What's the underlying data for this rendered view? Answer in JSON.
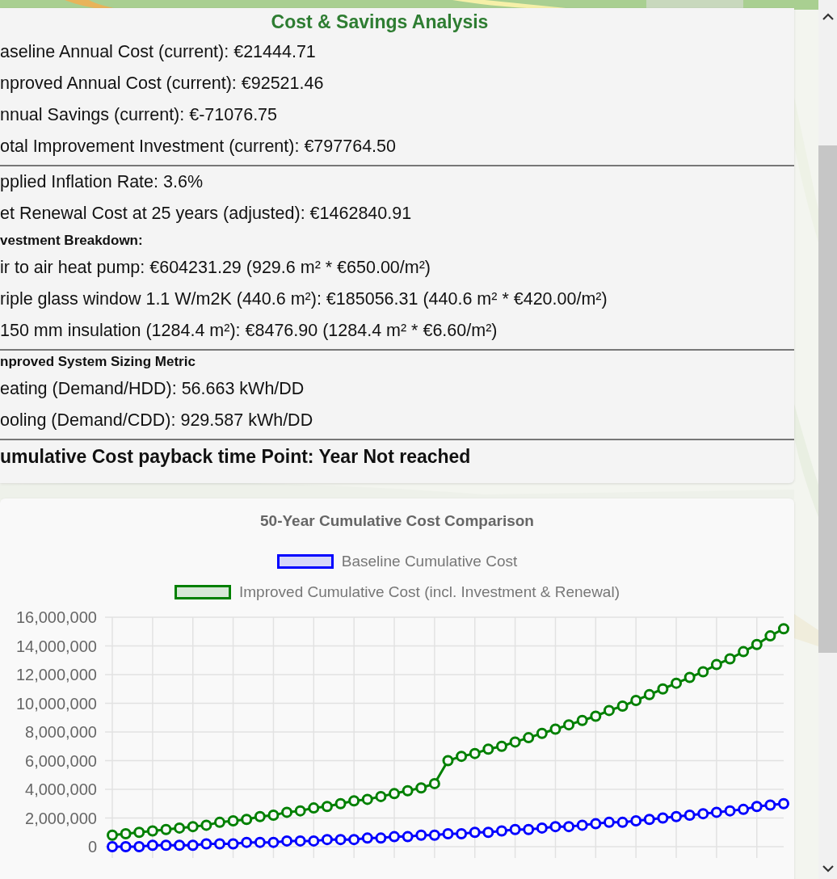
{
  "panel": {
    "title": "Cost & Savings Analysis",
    "groups": [
      {
        "rows": [
          {
            "kind": "line",
            "text": "aseline Annual Cost (current): €21444.71"
          },
          {
            "kind": "line",
            "text": "nproved Annual Cost (current): €92521.46"
          },
          {
            "kind": "line",
            "text": "nnual Savings (current): €-71076.75"
          },
          {
            "kind": "line",
            "text": "otal Improvement Investment (current): €797764.50"
          }
        ]
      },
      {
        "rows": [
          {
            "kind": "line",
            "text": "pplied Inflation Rate: 3.6%"
          },
          {
            "kind": "line",
            "text": "et Renewal Cost at 25 years (adjusted): €1462840.91"
          },
          {
            "kind": "heading",
            "text": "vestment Breakdown:"
          },
          {
            "kind": "line",
            "text": "ir to air heat pump: €604231.29 (929.6 m² * €650.00/m²)"
          },
          {
            "kind": "line",
            "text": "riple glass window 1.1 W/m2K (440.6 m²): €185056.31 (440.6 m² * €420.00/m²)"
          },
          {
            "kind": "line",
            "text": "150 mm insulation (1284.4 m²): €8476.90 (1284.4 m² * €6.60/m²)"
          }
        ]
      },
      {
        "rows": [
          {
            "kind": "heading",
            "text": "nproved System Sizing Metric"
          },
          {
            "kind": "line",
            "text": "eating (Demand/HDD): 56.663 kWh/DD"
          },
          {
            "kind": "line",
            "text": "ooling (Demand/CDD): 929.587 kWh/DD"
          }
        ]
      },
      {
        "rows": [
          {
            "kind": "result",
            "text": "umulative Cost payback time Point: Year Not reached"
          }
        ]
      }
    ]
  },
  "chart": {
    "chart_data": {
      "type": "line",
      "title": "50-Year Cumulative Cost Comparison",
      "grid": true,
      "series": [
        {
          "name": "Baseline Cumulative Cost",
          "color": "#0000ff",
          "marker": "circle",
          "values": [
            0,
            0,
            0,
            100000,
            100000,
            100000,
            100000,
            200000,
            200000,
            200000,
            300000,
            300000,
            300000,
            400000,
            400000,
            400000,
            500000,
            500000,
            500000,
            600000,
            600000,
            700000,
            700000,
            800000,
            800000,
            900000,
            900000,
            1000000,
            1000000,
            1100000,
            1200000,
            1200000,
            1300000,
            1400000,
            1400000,
            1500000,
            1600000,
            1700000,
            1700000,
            1800000,
            1900000,
            2000000,
            2100000,
            2200000,
            2300000,
            2400000,
            2500000,
            2600000,
            2800000,
            2900000,
            3000000
          ]
        },
        {
          "name": "Improved Cumulative Cost (incl. Investment & Renewal)",
          "color": "#008000",
          "marker": "circle",
          "values": [
            800000,
            900000,
            1000000,
            1100000,
            1200000,
            1300000,
            1400000,
            1500000,
            1700000,
            1800000,
            1900000,
            2100000,
            2200000,
            2400000,
            2500000,
            2700000,
            2800000,
            3000000,
            3200000,
            3300000,
            3500000,
            3700000,
            3900000,
            4100000,
            4400000,
            6000000,
            6300000,
            6500000,
            6800000,
            7000000,
            7300000,
            7600000,
            7900000,
            8200000,
            8500000,
            8800000,
            9100000,
            9500000,
            9800000,
            10200000,
            10600000,
            11000000,
            11400000,
            11800000,
            12200000,
            12700000,
            13100000,
            13600000,
            14100000,
            14700000,
            15200000
          ]
        }
      ],
      "ylim": [
        0,
        16000000
      ],
      "yticks": [
        {
          "value": 0,
          "label": "0"
        },
        {
          "value": 2000000,
          "label": "2,000,000"
        },
        {
          "value": 4000000,
          "label": "4,000,000"
        },
        {
          "value": 6000000,
          "label": "6,000,000"
        },
        {
          "value": 8000000,
          "label": "8,000,000"
        },
        {
          "value": 10000000,
          "label": "10,000,000"
        },
        {
          "value": 12000000,
          "label": "12,000,000"
        },
        {
          "value": 14000000,
          "label": "14,000,000"
        },
        {
          "value": 16000000,
          "label": "16,000,000"
        }
      ]
    }
  }
}
